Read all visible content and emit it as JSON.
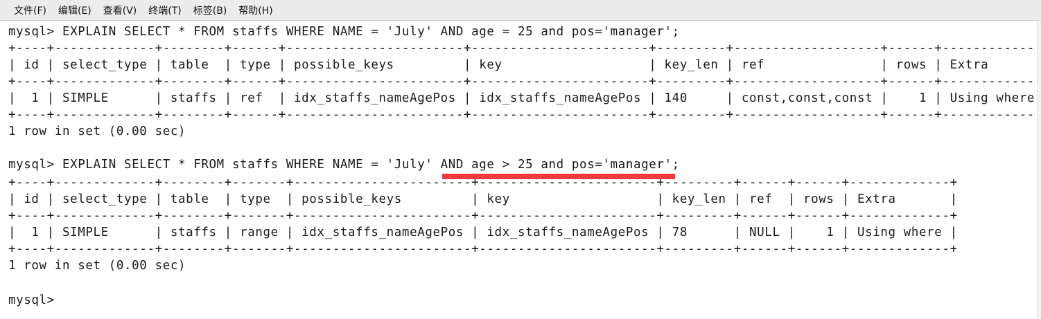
{
  "menu": {
    "file": "文件(F)",
    "edit": "编辑(E)",
    "view": "查看(V)",
    "terminal": "终端(T)",
    "tabs": "标签(B)",
    "help": "帮助(H)"
  },
  "terminal": {
    "lines": [
      "mysql> EXPLAIN SELECT * FROM staffs WHERE NAME = 'July' AND age = 25 and pos='manager';",
      "+----+-------------+--------+------+-----------------------+-----------------------+---------+-------------------+------+-------------+",
      "| id | select_type | table  | type | possible_keys         | key                   | key_len | ref               | rows | Extra       |",
      "+----+-------------+--------+------+-----------------------+-----------------------+---------+-------------------+------+-------------+",
      "|  1 | SIMPLE      | staffs | ref  | idx_staffs_nameAgePos | idx_staffs_nameAgePos | 140     | const,const,const |    1 | Using where |",
      "+----+-------------+--------+------+-----------------------+-----------------------+---------+-------------------+------+-------------+",
      "1 row in set (0.00 sec)",
      "",
      "mysql> EXPLAIN SELECT * FROM staffs WHERE NAME = 'July' AND age > 25 and pos='manager';",
      "+----+-------------+--------+-------+-----------------------+-----------------------+---------+------+------+-------------+",
      "| id | select_type | table  | type  | possible_keys         | key                   | key_len | ref  | rows | Extra       |",
      "+----+-------------+--------+-------+-----------------------+-----------------------+---------+------+------+-------------+",
      "|  1 | SIMPLE      | staffs | range | idx_staffs_nameAgePos | idx_staffs_nameAgePos | 78      | NULL |    1 | Using where |",
      "+----+-------------+--------+-------+-----------------------+-----------------------+---------+------+------+-------------+",
      "1 row in set (0.00 sec)",
      "",
      "mysql>"
    ]
  },
  "highlight_color": "#f03a3f"
}
